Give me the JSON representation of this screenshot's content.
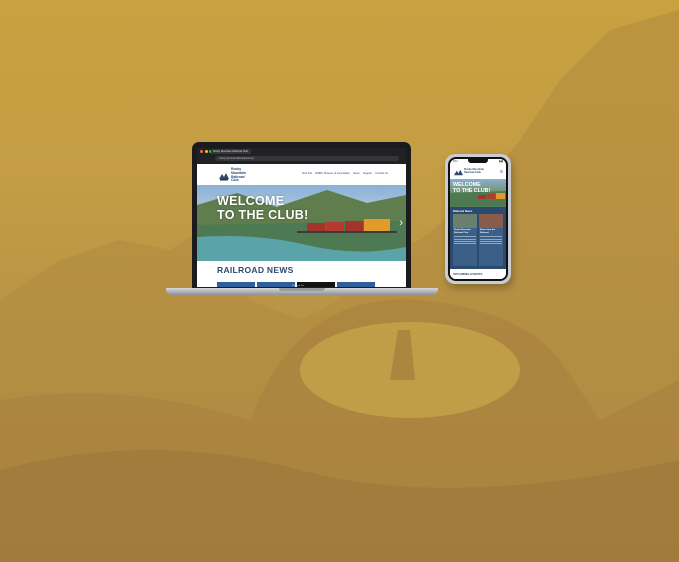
{
  "laptop": {
    "brand": "MacBook Pro",
    "browser": {
      "tab_title": "Rocky Mountain Railroad Club",
      "url": "rockymountainrailroadclub.org"
    },
    "site": {
      "logo_text": "Rocky Mountain Railroad Club",
      "nav": [
        "Club Info",
        "RMRC Museum & Foundation",
        "News",
        "Support",
        "Contact Us"
      ],
      "hero_line1": "WELCOME",
      "hero_line2": "TO THE CLUB!",
      "hero_next": "›",
      "news_title": "RAILROAD NEWS"
    }
  },
  "phone": {
    "time": "9:41",
    "signal": "▮▮▮",
    "logo_text": "Rocky Mountain Railroad Club",
    "menu_icon": "≡",
    "hero_line1": "WELCOME",
    "hero_line2": "TO THE CLUB!",
    "section_title": "Railroad News",
    "card1_title": "Rocky Mountain Railroad Club",
    "card2_title": "News from the Railroad",
    "events_title": "UPCOMING EVENTS"
  },
  "colors": {
    "brand_navy": "#2b4a6e",
    "background_gold": "#c49d44"
  }
}
